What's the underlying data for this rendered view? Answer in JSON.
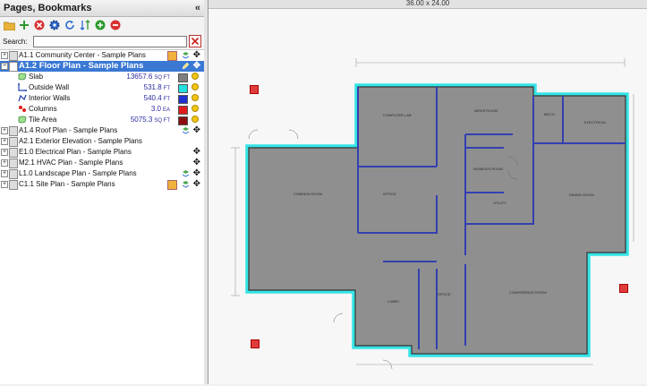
{
  "panel": {
    "title": "Pages, Bookmarks",
    "collapse_glyph": "«",
    "search_label": "Search:",
    "search_value": "",
    "toolbar_icons": [
      "folder-icon",
      "add-icon",
      "delete-icon",
      "settings-icon",
      "refresh-icon",
      "sort-icon",
      "add-circle-icon",
      "remove-circle-icon"
    ]
  },
  "tree": [
    {
      "label": "A1.1 Community Center - Sample Plans",
      "expand": "+",
      "selected": false,
      "extra": "icons"
    },
    {
      "label": "A1.2 Floor Plan - Sample Plans",
      "expand": "−",
      "selected": true
    },
    {
      "label": "A1.4 Roof Plan - Sample Plans",
      "expand": "+",
      "selected": false
    },
    {
      "label": "A2.1 Exterior Elevation - Sample Plans",
      "expand": "+",
      "selected": false
    },
    {
      "label": "E1.0 Electrical Plan - Sample Plans",
      "expand": "+",
      "selected": false
    },
    {
      "label": "M2.1 HVAC Plan - Sample Plans",
      "expand": "+",
      "selected": false
    },
    {
      "label": "L1.0 Landscape Plan - Sample Plans",
      "expand": "+",
      "selected": false
    },
    {
      "label": "C1.1 Site Plan - Sample Plans",
      "expand": "+",
      "selected": false
    }
  ],
  "measurements": [
    {
      "label": "Slab",
      "value": "13657.6",
      "unit": "SQ FT",
      "color": "#7f7f7f"
    },
    {
      "label": "Outside Wall",
      "value": "531.8",
      "unit": "FT",
      "color": "#22e0e0"
    },
    {
      "label": "Interior Walls",
      "value": "540.4",
      "unit": "FT",
      "color": "#1f2fd0"
    },
    {
      "label": "Columns",
      "value": "3.0",
      "unit": "EA",
      "color": "#e21b1b"
    },
    {
      "label": "Tile Area",
      "value": "5075.3",
      "unit": "SQ FT",
      "color": "#8b0d0d"
    }
  ],
  "viewer": {
    "page_size": "36.00 x 24.00",
    "rooms": [
      "COMPUTER LAB",
      "MEN'S ROOM",
      "MECH",
      "ELECTRICAL",
      "COMMON ROOM",
      "OFFICE",
      "WOMEN'S ROOM",
      "DINING ROOM",
      "UTILITY",
      "LOBBY",
      "OFFICE",
      "CONFERENCE ROOM"
    ]
  }
}
